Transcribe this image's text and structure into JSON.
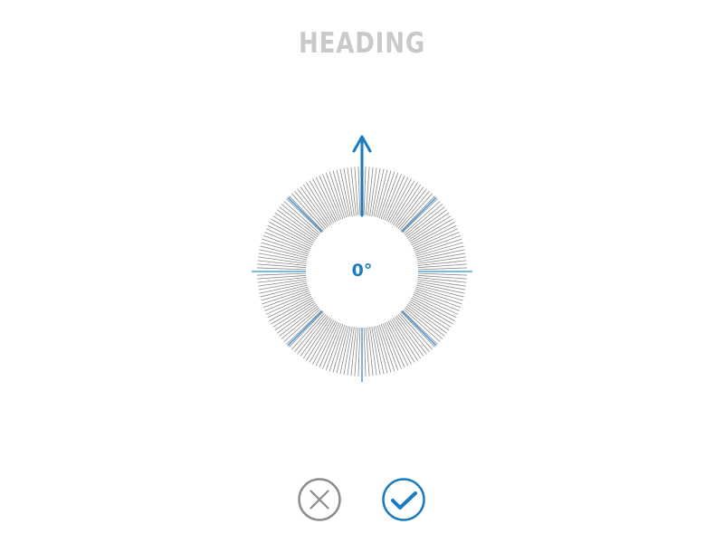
{
  "heading": {
    "title": "HEADING"
  },
  "dial": {
    "value_label": "0°",
    "heading_degrees": 0,
    "arrow_icon": "north-arrow-icon",
    "colors": {
      "ticks": "#8a8a8a",
      "cardinal_ticks": "#2e8fd0",
      "arrow": "#1a7bc0"
    }
  },
  "actions": {
    "cancel_icon": "close-circle-icon",
    "confirm_icon": "check-circle-icon",
    "colors": {
      "cancel": "#8c8c8c",
      "confirm": "#1a7bc0"
    }
  }
}
